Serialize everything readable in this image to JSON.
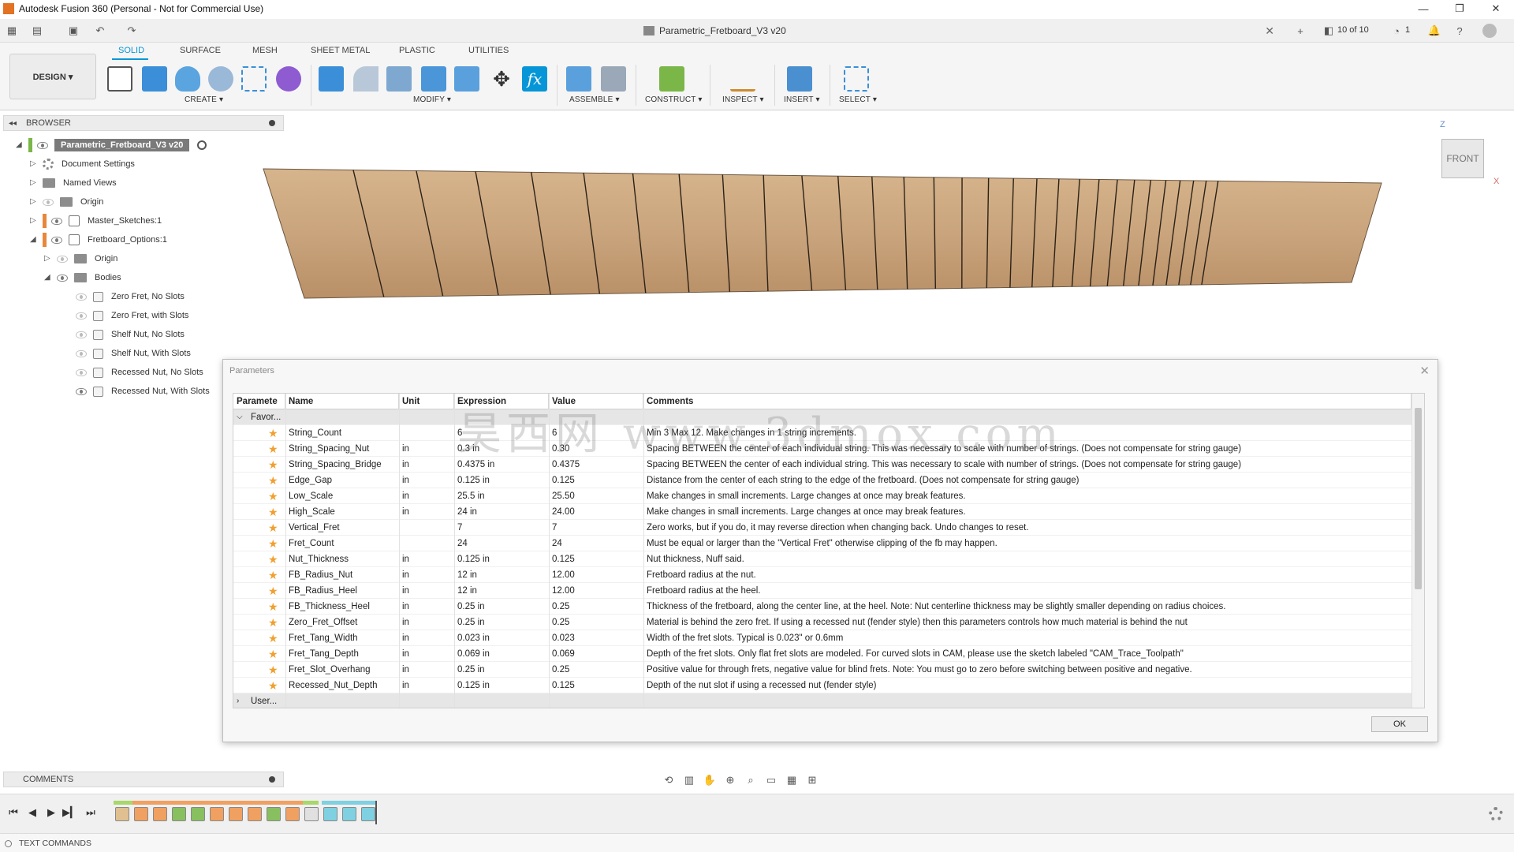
{
  "window": {
    "title": "Autodesk Fusion 360 (Personal - Not for Commercial Use)",
    "minimize": "—",
    "restore": "❐",
    "close": "✕"
  },
  "document": {
    "title": "Parametric_Fretboard_V3 v20",
    "close": "✕",
    "version_count": "10 of 10",
    "jobs_count": "1"
  },
  "ribbon": {
    "workspace_label": "DESIGN ▾",
    "tabs": [
      "SOLID",
      "SURFACE",
      "MESH",
      "SHEET METAL",
      "PLASTIC",
      "UTILITIES"
    ],
    "active_tab": "SOLID",
    "groups": [
      "CREATE ▾",
      "MODIFY ▾",
      "ASSEMBLE ▾",
      "CONSTRUCT ▾",
      "INSPECT ▾",
      "INSERT ▾",
      "SELECT ▾"
    ],
    "fx_label": "fx"
  },
  "browser": {
    "header": "BROWSER",
    "collapse_glyph": "◂◂",
    "root": "Parametric_Fretboard_V3 v20",
    "items": [
      {
        "label": "Document Settings"
      },
      {
        "label": "Named Views"
      },
      {
        "label": "Origin"
      },
      {
        "label": "Master_Sketches:1"
      },
      {
        "label": "Fretboard_Options:1"
      },
      {
        "label": "Origin"
      },
      {
        "label": "Bodies"
      },
      {
        "label": "Zero Fret, No Slots"
      },
      {
        "label": "Zero Fret, with Slots"
      },
      {
        "label": "Shelf Nut, No Slots"
      },
      {
        "label": "Shelf Nut, With Slots"
      },
      {
        "label": "Recessed Nut, No Slots"
      },
      {
        "label": "Recessed Nut, With Slots"
      }
    ]
  },
  "viewcube": {
    "face": "FRONT",
    "z": "Z",
    "x": "X"
  },
  "parameters": {
    "title": "Parameters",
    "close": "✕",
    "columns": [
      "Paramete",
      "Name",
      "Unit",
      "Expression",
      "Value",
      "Comments"
    ],
    "group_favorites": "Favor...",
    "group_user": "User...",
    "rows": [
      {
        "name": "String_Count",
        "unit": "",
        "expr": "6",
        "value": "6",
        "comment": "Min 3 Max 12. Make changes in 1 string increments."
      },
      {
        "name": "String_Spacing_Nut",
        "unit": "in",
        "expr": "0.3 in",
        "value": "0.30",
        "comment": "Spacing BETWEEN the center of each individual string. This was necessary to scale with number of strings.  (Does not compensate for string gauge)"
      },
      {
        "name": "String_Spacing_Bridge",
        "unit": "in",
        "expr": "0.4375 in",
        "value": "0.4375",
        "comment": "Spacing BETWEEN the center of each individual string. This was necessary to scale with number of strings.  (Does not compensate for string gauge)"
      },
      {
        "name": "Edge_Gap",
        "unit": "in",
        "expr": "0.125 in",
        "value": "0.125",
        "comment": "Distance from the center of each string to the edge of the fretboard. (Does not compensate for string gauge)"
      },
      {
        "name": "Low_Scale",
        "unit": "in",
        "expr": "25.5 in",
        "value": "25.50",
        "comment": "Make changes in small increments. Large changes at once may break features."
      },
      {
        "name": "High_Scale",
        "unit": "in",
        "expr": "24 in",
        "value": "24.00",
        "comment": "Make changes in small increments. Large changes at once may break features."
      },
      {
        "name": "Vertical_Fret",
        "unit": "",
        "expr": "7",
        "value": "7",
        "comment": "Zero works, but if you do, it may reverse direction when changing back. Undo changes to reset."
      },
      {
        "name": "Fret_Count",
        "unit": "",
        "expr": "24",
        "value": "24",
        "comment": "Must be equal or larger than the \"Vertical Fret\" otherwise clipping of the fb may happen."
      },
      {
        "name": "Nut_Thickness",
        "unit": "in",
        "expr": "0.125 in",
        "value": "0.125",
        "comment": "Nut thickness, Nuff said."
      },
      {
        "name": "FB_Radius_Nut",
        "unit": "in",
        "expr": "12 in",
        "value": "12.00",
        "comment": "Fretboard radius at the nut."
      },
      {
        "name": "FB_Radius_Heel",
        "unit": "in",
        "expr": "12 in",
        "value": "12.00",
        "comment": "Fretboard radius at the heel."
      },
      {
        "name": "FB_Thickness_Heel",
        "unit": "in",
        "expr": "0.25 in",
        "value": "0.25",
        "comment": "Thickness of the fretboard, along the center line, at the heel. Note: Nut centerline thickness may be slightly smaller depending on radius choices."
      },
      {
        "name": "Zero_Fret_Offset",
        "unit": "in",
        "expr": "0.25 in",
        "value": "0.25",
        "comment": "Material is behind the zero fret. If using a recessed nut (fender style) then this parameters controls how much material is behind the nut"
      },
      {
        "name": "Fret_Tang_Width",
        "unit": "in",
        "expr": "0.023 in",
        "value": "0.023",
        "comment": "Width of the fret slots. Typical is 0.023\" or 0.6mm"
      },
      {
        "name": "Fret_Tang_Depth",
        "unit": "in",
        "expr": "0.069 in",
        "value": "0.069",
        "comment": "Depth of the fret slots. Only flat fret slots are modeled. For curved slots in CAM, please use the sketch labeled \"CAM_Trace_Toolpath\""
      },
      {
        "name": "Fret_Slot_Overhang",
        "unit": "in",
        "expr": "0.25 in",
        "value": "0.25",
        "comment": "Positive value for through frets, negative value for blind frets. Note: You must go to zero before switching between positive and negative."
      },
      {
        "name": "Recessed_Nut_Depth",
        "unit": "in",
        "expr": "0.125 in",
        "value": "0.125",
        "comment": "Depth of the nut slot if using a recessed nut (fender style)"
      }
    ],
    "ok_label": "OK"
  },
  "watermark": "昊西网 www.3dmox.com",
  "comments": {
    "label": "COMMENTS"
  },
  "text_commands": {
    "label": "TEXT COMMANDS"
  },
  "colors": {
    "accent": "#0696d7",
    "star": "#f0a030",
    "wood": "#c9a47c"
  }
}
